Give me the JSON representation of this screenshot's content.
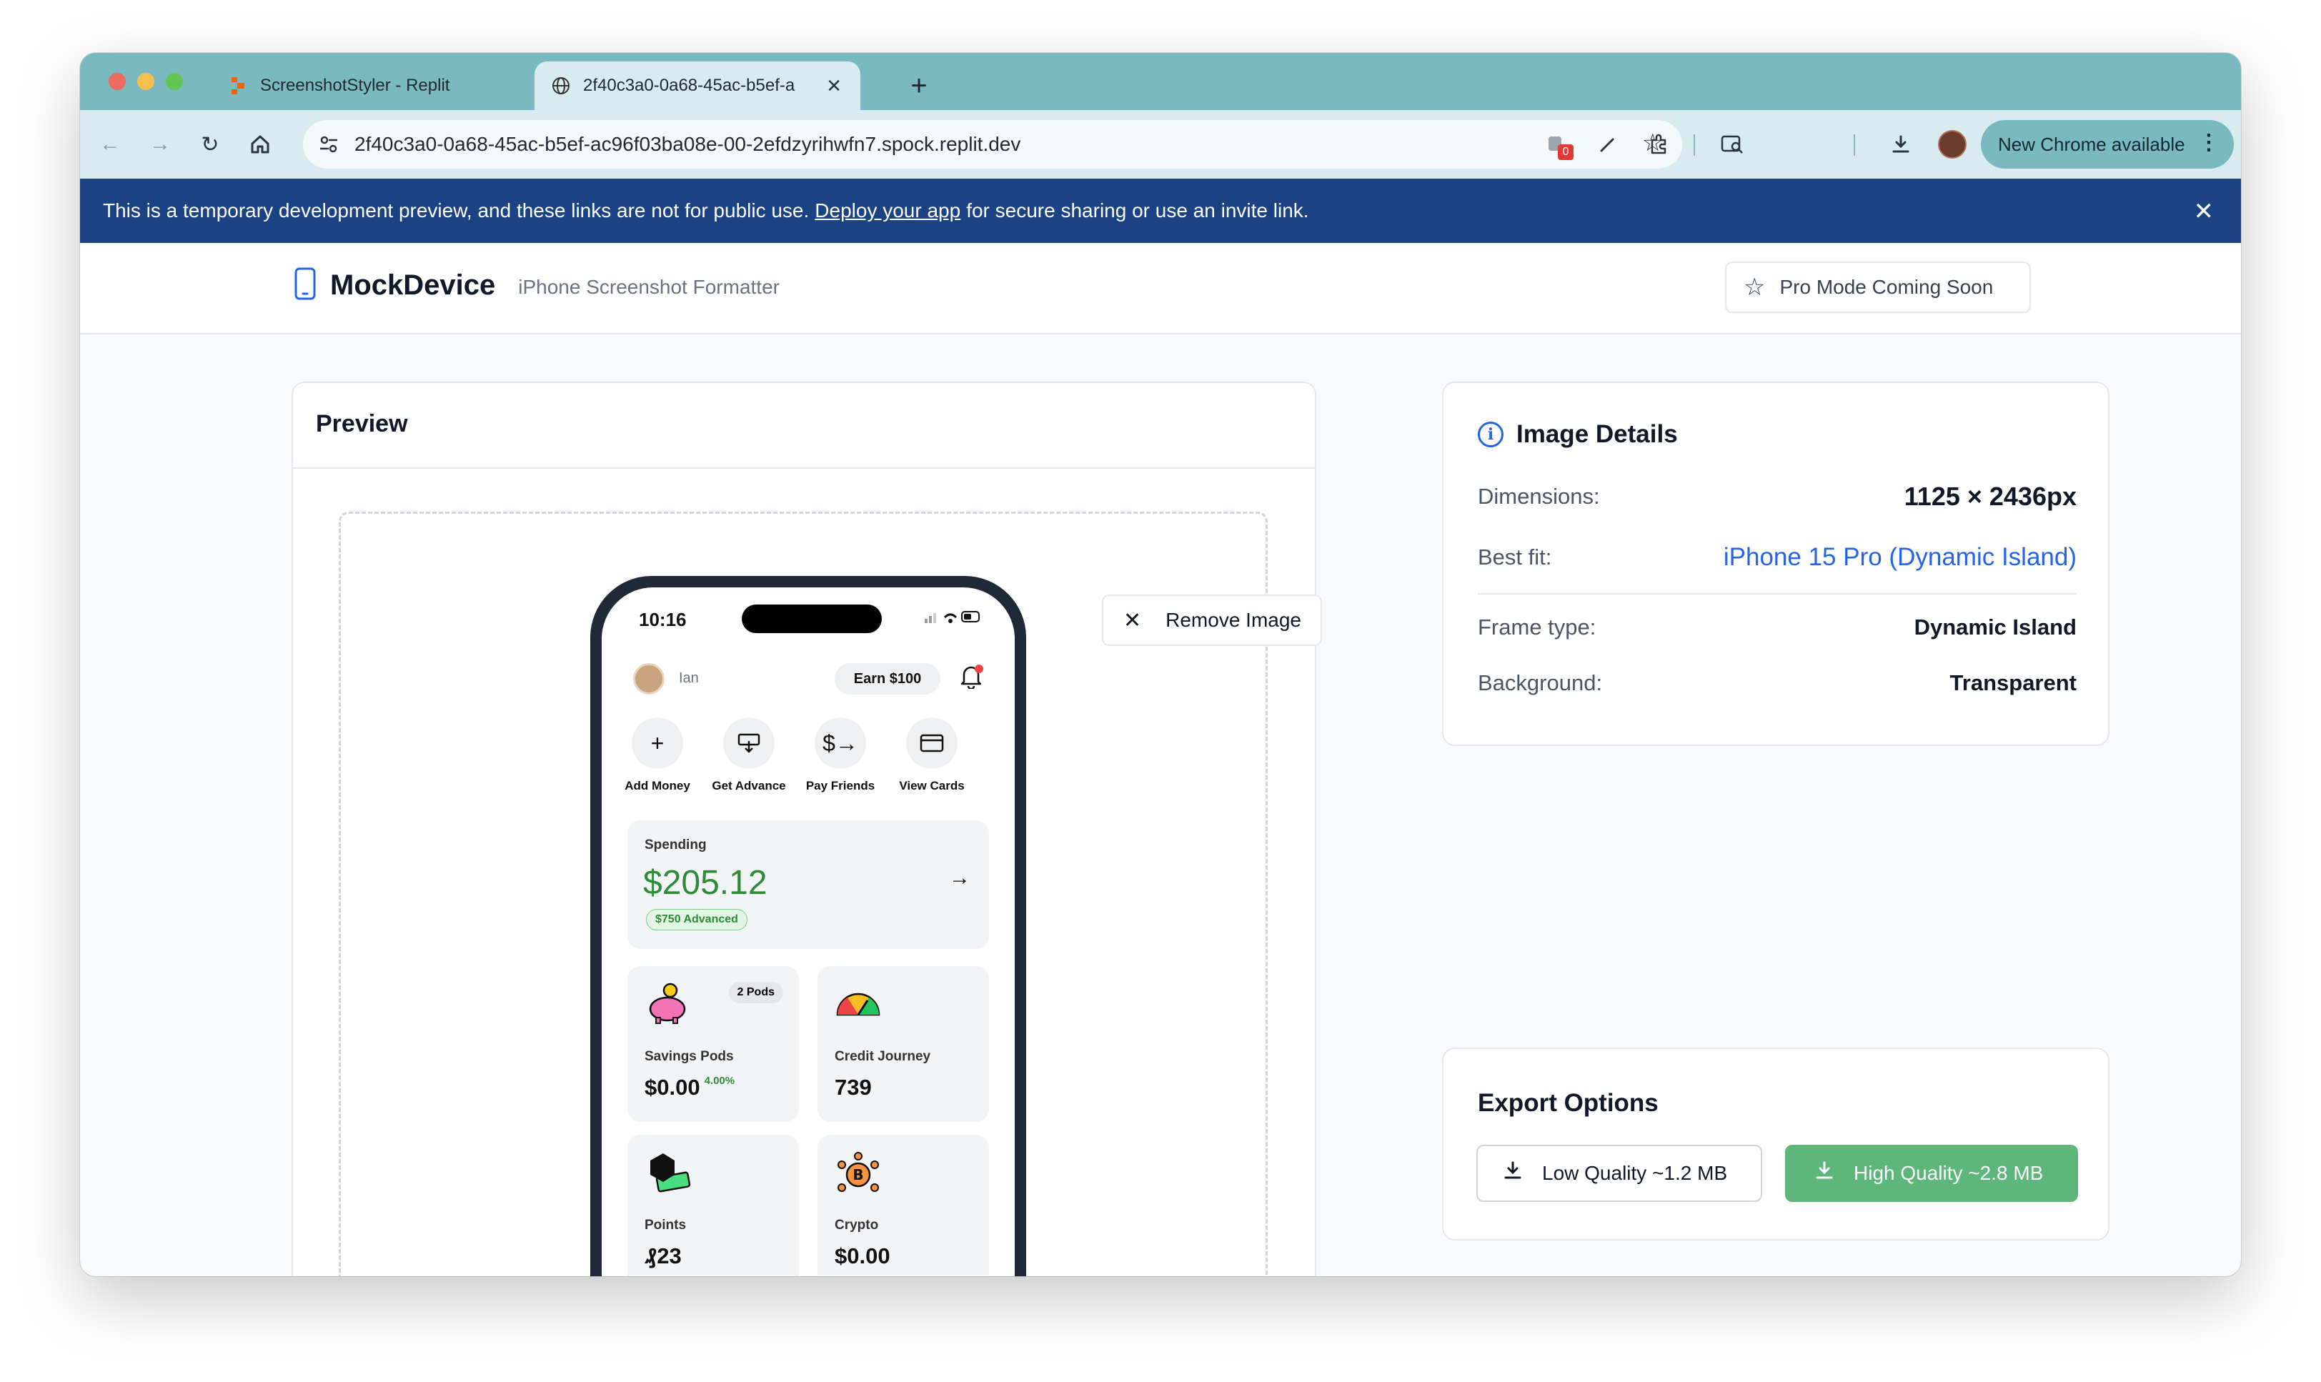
{
  "browser": {
    "tabs": [
      {
        "title": "ScreenshotStyler - Replit",
        "icon": "replit-icon"
      },
      {
        "title": "2f40c3a0-0a68-45ac-b5ef-a",
        "icon": "globe-icon"
      }
    ],
    "url": "2f40c3a0-0a68-45ac-b5ef-ac96f03ba08e-00-2efdzyrihwfn7.spock.replit.dev",
    "chrome_update": "New Chrome available",
    "extension_badge": "0"
  },
  "banner": {
    "text_before": "This is a temporary development preview, and these links are not for public use.",
    "link": "Deploy your app",
    "text_after": "for secure sharing or use an invite link."
  },
  "header": {
    "app_name": "MockDevice",
    "subtitle": "iPhone Screenshot Formatter",
    "pro_button": "Pro Mode Coming Soon"
  },
  "preview": {
    "title": "Preview",
    "remove_button": "Remove Image",
    "phone": {
      "time": "10:16",
      "user_name": "Ian",
      "earn_label": "Earn $100",
      "actions": [
        "Add Money",
        "Get Advance",
        "Pay Friends",
        "View Cards"
      ],
      "spending_label": "Spending",
      "spending_amount": "$205.12",
      "advanced_badge": "$750 Advanced",
      "tiles": [
        {
          "title": "Savings Pods",
          "value": "$0.00",
          "extra": "4.00%",
          "badge": "2 Pods"
        },
        {
          "title": "Credit Journey",
          "value": "739"
        },
        {
          "title": "Points",
          "value": "₰23"
        },
        {
          "title": "Crypto",
          "value": "$0.00"
        }
      ]
    }
  },
  "details": {
    "title": "Image Details",
    "rows": [
      {
        "key": "Dimensions:",
        "value": "1125 × 2436px"
      },
      {
        "key": "Best fit:",
        "value": "iPhone 15 Pro (Dynamic Island)"
      },
      {
        "key": "Frame type:",
        "value": "Dynamic Island"
      },
      {
        "key": "Background:",
        "value": "Transparent"
      }
    ]
  },
  "export": {
    "title": "Export Options",
    "low_quality": "Low Quality ~1.2 MB",
    "high_quality": "High Quality ~2.8 MB"
  },
  "colors": {
    "banner": "#1b4384",
    "accent_blue": "#2563eb",
    "export_green": "#5db67a",
    "spending_green": "#2e8b3a"
  }
}
